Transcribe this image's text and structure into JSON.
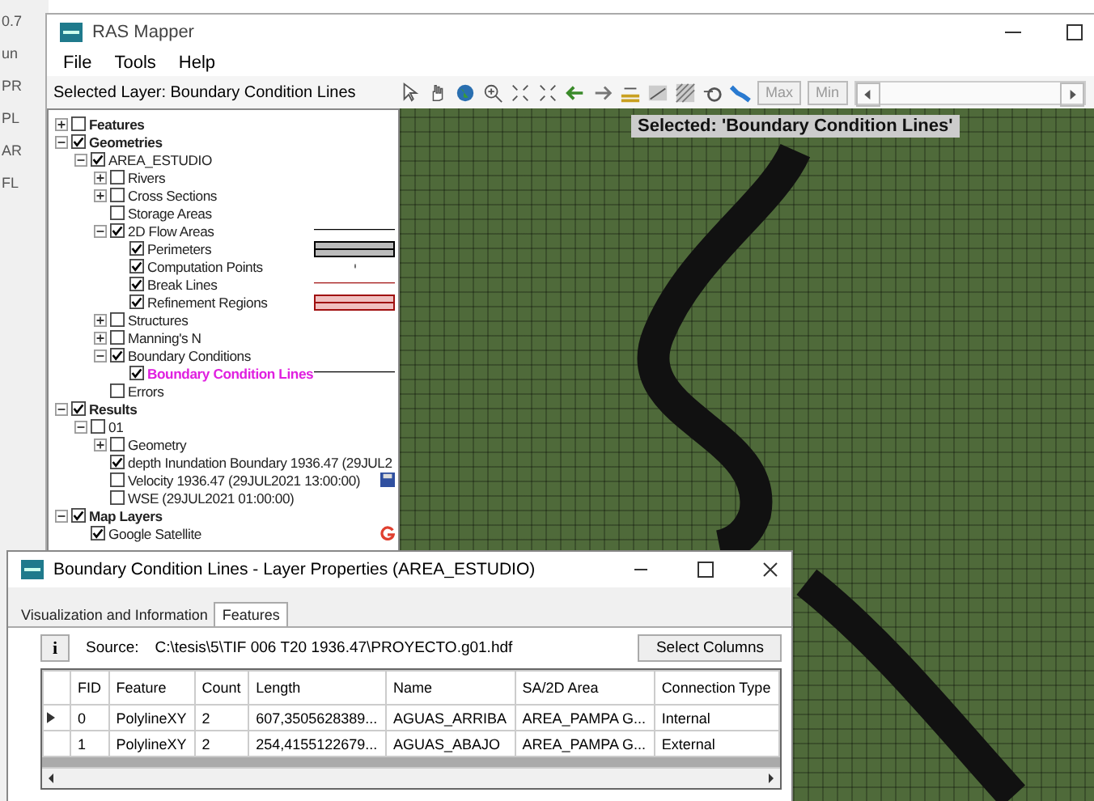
{
  "background_app": {
    "texts": [
      "0.7",
      "un",
      "PR",
      "PL",
      "AR",
      "FL"
    ]
  },
  "window": {
    "title": "RAS Mapper",
    "menu": [
      "File",
      "Tools",
      "Help"
    ],
    "selected_layer": "Selected Layer: Boundary Condition Lines",
    "toolbar": {
      "buttons": [
        "Max",
        "Min"
      ]
    },
    "tree": [
      {
        "label": "Features",
        "checked": false,
        "expanded": false,
        "bold": true,
        "selected": false
      },
      {
        "label": "Geometries",
        "checked": true,
        "expanded": true,
        "bold": true,
        "selected": false,
        "children": [
          {
            "label": "AREA_ESTUDIO",
            "checked": true,
            "expanded": true,
            "bold": false,
            "selected": false,
            "children": [
              {
                "label": "Rivers",
                "checked": false,
                "expanded": false,
                "bold": false,
                "selected": false
              },
              {
                "label": "Cross Sections",
                "checked": false,
                "expanded": false,
                "bold": false,
                "selected": false
              },
              {
                "label": "Storage Areas",
                "checked": false,
                "bold": false,
                "selected": false
              },
              {
                "kind": "line",
                "label": "2D Flow Areas",
                "checked": true,
                "expanded": true,
                "bold": false,
                "selected": false,
                "children": [
                  {
                    "kind": "box",
                    "label": "Perimeters",
                    "checked": true,
                    "bold": false,
                    "selected": false
                  },
                  {
                    "kind": "dot",
                    "label": "Computation Points",
                    "checked": true,
                    "bold": false,
                    "selected": false
                  },
                  {
                    "kind": "redline",
                    "label": "Break Lines",
                    "checked": true,
                    "bold": false,
                    "selected": false
                  },
                  {
                    "kind": "redbox",
                    "label": "Refinement Regions",
                    "checked": true,
                    "bold": false,
                    "selected": false
                  }
                ]
              },
              {
                "label": "Structures",
                "checked": false,
                "expanded": false,
                "bold": false,
                "selected": false
              },
              {
                "label": "Manning's N",
                "checked": false,
                "expanded": false,
                "bold": false,
                "selected": false
              },
              {
                "label": "Boundary Conditions",
                "checked": true,
                "expanded": true,
                "bold": false,
                "selected": false,
                "children": [
                  {
                    "kind": "line",
                    "label": "Boundary Condition Lines",
                    "checked": true,
                    "bold": true,
                    "selected": true
                  }
                ]
              },
              {
                "label": "Errors",
                "checked": false,
                "bold": false,
                "selected": false
              }
            ]
          }
        ]
      },
      {
        "label": "Results",
        "checked": true,
        "expanded": true,
        "bold": true,
        "selected": false,
        "children": [
          {
            "label": "01",
            "checked": false,
            "expanded": true,
            "bold": false,
            "selected": false,
            "children": [
              {
                "label": "Geometry",
                "checked": false,
                "expanded": false,
                "bold": false,
                "selected": false
              },
              {
                "label": "depth Inundation Boundary 1936.47 (29JUL2",
                "checked": true,
                "bold": false,
                "selected": false
              },
              {
                "kind": "disk",
                "label": "Velocity 1936.47 (29JUL2021 13:00:00)",
                "checked": false,
                "bold": false,
                "selected": false
              },
              {
                "label": "WSE (29JUL2021 01:00:00)",
                "checked": false,
                "bold": false,
                "selected": false
              }
            ]
          }
        ]
      },
      {
        "label": "Map Layers",
        "checked": true,
        "expanded": true,
        "bold": true,
        "selected": false,
        "children": [
          {
            "kind": "google",
            "label": "Google Satellite",
            "checked": true,
            "bold": false,
            "selected": false
          }
        ]
      }
    ],
    "map": {
      "selected_label": "Selected: 'Boundary Condition Lines'"
    }
  },
  "dialog": {
    "title": "Boundary Condition Lines - Layer Properties (AREA_ESTUDIO)",
    "tabs": [
      {
        "label": "Visualization and Information",
        "selected": false
      },
      {
        "label": "Features",
        "selected": true
      }
    ],
    "info_button": "i",
    "source_label": "Source:",
    "source_path": "C:\\tesis\\5\\TIF 006 T20 1936.47\\PROYECTO.g01.hdf",
    "select_columns": "Select Columns",
    "table": {
      "columns": [
        "FID",
        "Feature",
        "Count",
        "Length",
        "Name",
        "SA/2D Area",
        "Connection Type"
      ],
      "rows": [
        {
          "current": true,
          "cells": [
            "0",
            "PolylineXY",
            "2",
            "607,3505628389...",
            "AGUAS_ARRIBA",
            "AREA_PAMPA G...",
            "Internal"
          ]
        },
        {
          "current": false,
          "cells": [
            "1",
            "PolylineXY",
            "2",
            "254,4155122679...",
            "AGUAS_ABAJO",
            "AREA_PAMPA G...",
            "External"
          ]
        }
      ]
    }
  }
}
